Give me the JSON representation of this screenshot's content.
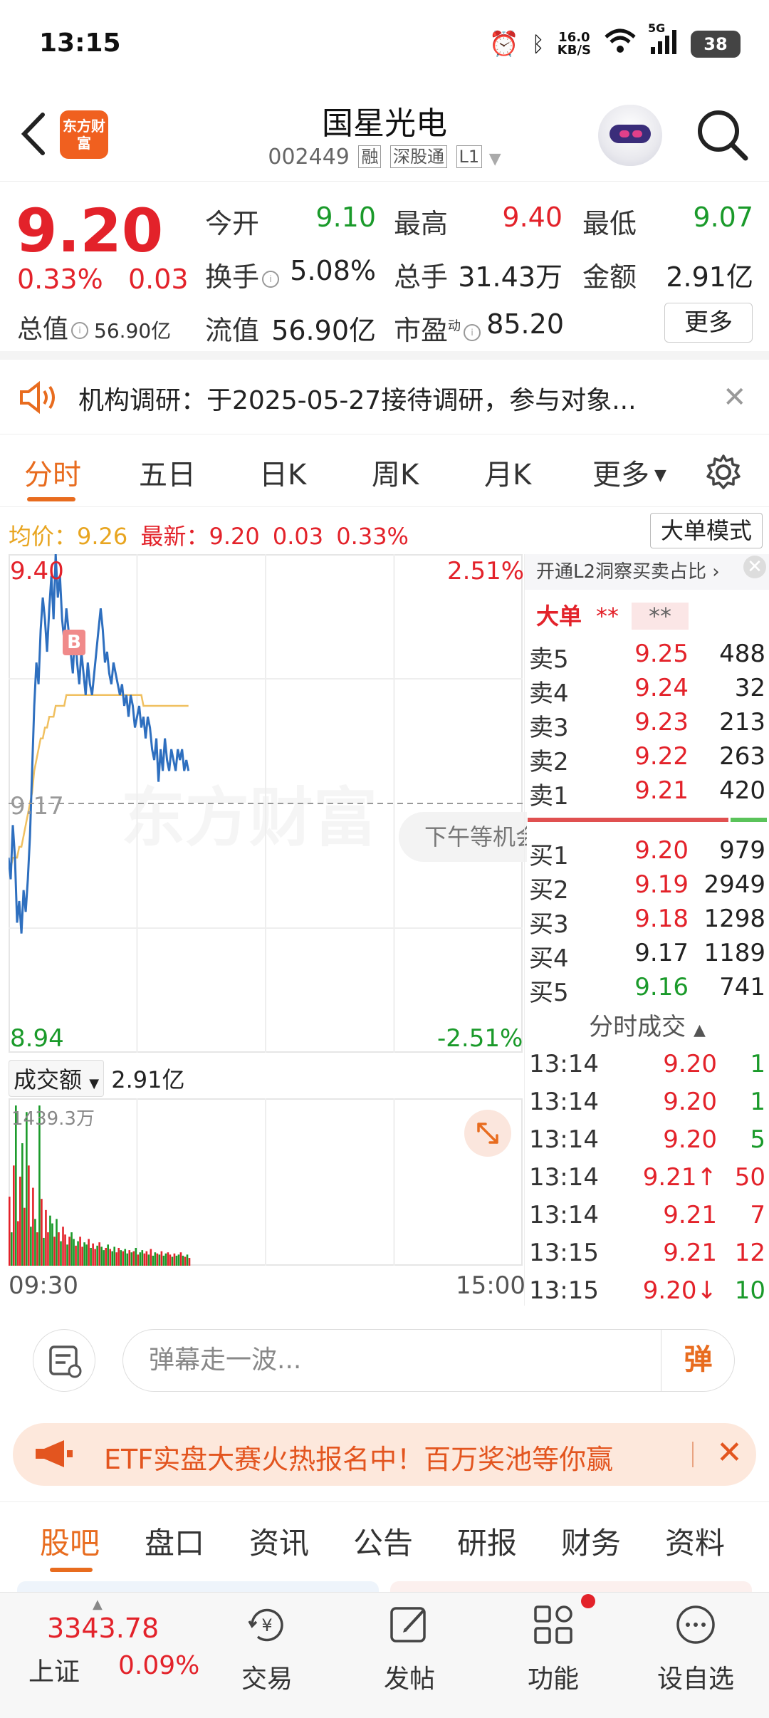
{
  "status_bar": {
    "time": "13:15",
    "net_speed_value": "16.0",
    "net_speed_unit": "KB/S",
    "network": "5G",
    "battery": "38"
  },
  "header": {
    "stock_name": "国星光电",
    "code": "002449",
    "tags": [
      "融",
      "深股通",
      "L1"
    ],
    "logo_text": "东方财富"
  },
  "quote": {
    "price": "9.20",
    "change_pct": "0.33%",
    "change": "0.03",
    "open_label": "今开",
    "open": "9.10",
    "high_label": "最高",
    "high": "9.40",
    "low_label": "最低",
    "low": "9.07",
    "turnover_label": "换手",
    "turnover": "5.08%",
    "volume_label": "总手",
    "volume": "31.43万",
    "amount_label": "金额",
    "amount": "2.91亿",
    "total_value_label": "总值",
    "total_value": "56.90亿",
    "float_value_label": "流值",
    "float_value": "56.90亿",
    "pe_label": "市盈",
    "pe_sup": "动",
    "pe": "85.20",
    "more_label": "更多"
  },
  "notice": {
    "text": "机构调研：于2025-05-27接待调研，参与对象..."
  },
  "chart_tabs": {
    "items": [
      "分时",
      "五日",
      "日K",
      "周K",
      "月K",
      "更多"
    ],
    "active": 0
  },
  "intraday": {
    "avg_label": "均价：",
    "avg": "9.26",
    "latest_label": "最新：",
    "latest": "9.20",
    "latest_change": "0.03",
    "latest_pct": "0.33%",
    "big_order_mode": "大单模式",
    "upper_price": "9.40",
    "upper_pct": "2.51%",
    "prev_close": "9.17",
    "lower_price": "8.94",
    "lower_pct": "-2.51%",
    "afternoon_tip": "下午等机会",
    "watermark": "东方财富",
    "buy_marker": "B",
    "volume_selector": "成交额",
    "volume_total": "2.91亿",
    "volume_max": "1439.3万",
    "time_start": "09:30",
    "time_end": "15:00"
  },
  "chart_data": {
    "type": "line",
    "title": "",
    "ylim": [
      8.94,
      9.4
    ],
    "reference": 9.17,
    "series": [
      {
        "name": "",
        "values": [
          9.12,
          9.1,
          9.15,
          9.12,
          9.06,
          9.08,
          9.05,
          9.09,
          9.07,
          9.1,
          9.14,
          9.2,
          9.26,
          9.3,
          9.28,
          9.33,
          9.36,
          9.34,
          9.31,
          9.35,
          9.38,
          9.34,
          9.4,
          9.36,
          9.38,
          9.34,
          9.32,
          9.35,
          9.33,
          9.31,
          9.29,
          9.33,
          9.3,
          9.28,
          9.31,
          9.29,
          9.27,
          9.3,
          9.28,
          9.27,
          9.29,
          9.31,
          9.33,
          9.35,
          9.33,
          9.3,
          9.31,
          9.29,
          9.28,
          9.3,
          9.29,
          9.28,
          9.27,
          9.28,
          9.26,
          9.27,
          9.25,
          9.27,
          9.26,
          9.24,
          9.25,
          9.26,
          9.24,
          9.25,
          9.23,
          9.25,
          9.24,
          9.22,
          9.21,
          9.23,
          9.19,
          9.22,
          9.2,
          9.23,
          9.21,
          9.2,
          9.22,
          9.21,
          9.2,
          9.22,
          9.21,
          9.22,
          9.2,
          9.21,
          9.2
        ]
      },
      {
        "name": "",
        "values": [
          9.11,
          9.11,
          9.12,
          9.12,
          9.12,
          9.13,
          9.13,
          9.14,
          9.15,
          9.16,
          9.17,
          9.18,
          9.2,
          9.21,
          9.22,
          9.23,
          9.23,
          9.24,
          9.24,
          9.25,
          9.25,
          9.25,
          9.26,
          9.26,
          9.26,
          9.26,
          9.26,
          9.27,
          9.27,
          9.27,
          9.27,
          9.27,
          9.27,
          9.27,
          9.27,
          9.27,
          9.27,
          9.27,
          9.27,
          9.27,
          9.27,
          9.27,
          9.27,
          9.27,
          9.27,
          9.27,
          9.27,
          9.27,
          9.27,
          9.27,
          9.27,
          9.27,
          9.27,
          9.27,
          9.27,
          9.27,
          9.27,
          9.27,
          9.27,
          9.27,
          9.27,
          9.27,
          9.27,
          9.26,
          9.26,
          9.26,
          9.26,
          9.26,
          9.26,
          9.26,
          9.26,
          9.26,
          9.26,
          9.26,
          9.26,
          9.26,
          9.26,
          9.26,
          9.26,
          9.26,
          9.26,
          9.26,
          9.26,
          9.26,
          9.26
        ]
      }
    ],
    "total_points": 241,
    "volume": {
      "ylim": [
        0,
        1439.3
      ],
      "values": [
        620,
        300,
        900,
        1439,
        400,
        800,
        1100,
        520,
        1380,
        900,
        350,
        700,
        420,
        300,
        1439,
        600,
        250,
        500,
        300,
        450,
        380,
        260,
        420,
        300,
        220,
        350,
        280,
        190,
        260,
        300,
        240,
        180,
        220,
        260,
        170,
        210,
        190,
        240,
        160,
        200,
        150,
        180,
        210,
        170,
        140,
        160,
        190,
        150,
        130,
        170,
        120,
        160,
        140,
        130,
        150,
        110,
        140,
        120,
        130,
        160,
        100,
        120,
        140,
        110,
        130,
        100,
        150,
        90,
        120,
        110,
        100,
        130,
        90,
        110,
        120,
        100,
        80,
        110,
        90,
        100,
        120,
        90,
        80,
        100,
        70
      ],
      "up": [
        1,
        0,
        1,
        0,
        1,
        1,
        0,
        1,
        0,
        1,
        0,
        1,
        0,
        1,
        0,
        1,
        0,
        1,
        1,
        0,
        0,
        1,
        0,
        1,
        0,
        1,
        1,
        0,
        1,
        0,
        0,
        1,
        0,
        1,
        1,
        0,
        0,
        1,
        0,
        1,
        1,
        0,
        1,
        0,
        0,
        1,
        0,
        1,
        0,
        0,
        1,
        1,
        0,
        1,
        0,
        0,
        1,
        0,
        1,
        0,
        1,
        0,
        0,
        1,
        1,
        0,
        1,
        0,
        0,
        1,
        0,
        1,
        0,
        0,
        1,
        1,
        0,
        1,
        0,
        0,
        1,
        0,
        1,
        0,
        1
      ]
    }
  },
  "order_book": {
    "l2_promo": "开通L2洞察买卖占比",
    "big_label": "大单",
    "big_sell": "**",
    "big_buy": "**",
    "asks": [
      {
        "label": "卖5",
        "price": "9.25",
        "vol": "488"
      },
      {
        "label": "卖4",
        "price": "9.24",
        "vol": "32"
      },
      {
        "label": "卖3",
        "price": "9.23",
        "vol": "213"
      },
      {
        "label": "卖2",
        "price": "9.22",
        "vol": "263"
      },
      {
        "label": "卖1",
        "price": "9.21",
        "vol": "420"
      }
    ],
    "bids": [
      {
        "label": "买1",
        "price": "9.20",
        "vol": "979",
        "color": "red"
      },
      {
        "label": "买2",
        "price": "9.19",
        "vol": "2949",
        "color": "red"
      },
      {
        "label": "买3",
        "price": "9.18",
        "vol": "1298",
        "color": "red"
      },
      {
        "label": "买4",
        "price": "9.17",
        "vol": "1189",
        "color": "black"
      },
      {
        "label": "买5",
        "price": "9.16",
        "vol": "741",
        "color": "green"
      }
    ],
    "ticks_header": "分时成交",
    "ticks": [
      {
        "time": "13:14",
        "price": "9.20",
        "vol": "1",
        "dir": "green"
      },
      {
        "time": "13:14",
        "price": "9.20",
        "vol": "1",
        "dir": "green"
      },
      {
        "time": "13:14",
        "price": "9.20",
        "vol": "5",
        "dir": "green"
      },
      {
        "time": "13:14",
        "price": "9.21↑",
        "vol": "50",
        "dir": "red"
      },
      {
        "time": "13:14",
        "price": "9.21",
        "vol": "7",
        "dir": "red"
      },
      {
        "time": "13:15",
        "price": "9.21",
        "vol": "12",
        "dir": "red"
      },
      {
        "time": "13:15",
        "price": "9.20↓",
        "vol": "10",
        "dir": "green"
      }
    ]
  },
  "danmu": {
    "placeholder": "弹幕走一波...",
    "button": "弹"
  },
  "ad": {
    "text": "ETF实盘大赛火热报名中！百万奖池等你赢"
  },
  "bottom_tabs": {
    "items": [
      "股吧",
      "盘口",
      "资讯",
      "公告",
      "研报",
      "财务",
      "资料"
    ],
    "active": 0
  },
  "nav": {
    "index_value": "3343.78",
    "index_name": "上证",
    "index_pct": "0.09%",
    "items": [
      "交易",
      "发帖",
      "功能",
      "设自选"
    ]
  },
  "colors": {
    "up": "#e3222a",
    "down": "#1a9a2a",
    "accent": "#e86c1f",
    "avg_line": "#f0c060",
    "price_line": "#2e6fbf"
  }
}
